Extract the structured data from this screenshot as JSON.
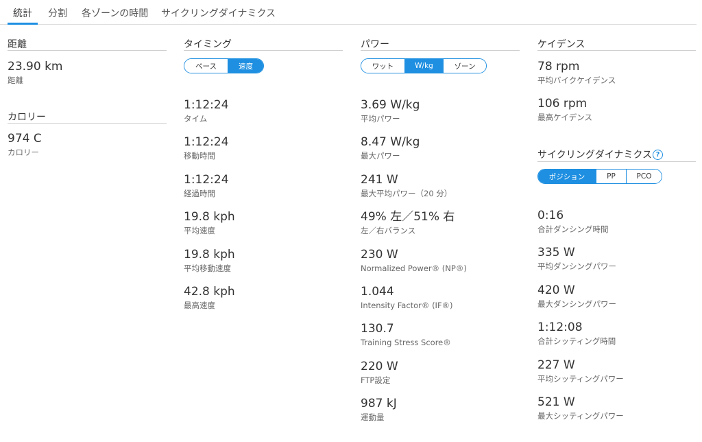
{
  "colors": {
    "accent": "#1e8fe1",
    "text": "#333333",
    "subtext": "#666666",
    "divider": "#cfcfcf"
  },
  "tabs": [
    "統計",
    "分割",
    "各ゾーンの時間",
    "サイクリングダイナミクス"
  ],
  "distance": {
    "heading": "距離",
    "value": "23.90 km",
    "label": "距離"
  },
  "calories": {
    "heading": "カロリー",
    "value": "974 C",
    "label": "カロリー"
  },
  "timing": {
    "heading": "タイミング",
    "toggle": [
      "ペース",
      "速度"
    ],
    "selected": "速度",
    "stats": [
      {
        "value": "1:12:24",
        "label": "タイム"
      },
      {
        "value": "1:12:24",
        "label": "移動時間"
      },
      {
        "value": "1:12:24",
        "label": "経過時間"
      },
      {
        "value": "19.8 kph",
        "label": "平均速度"
      },
      {
        "value": "19.8 kph",
        "label": "平均移動速度"
      },
      {
        "value": "42.8 kph",
        "label": "最高速度"
      }
    ]
  },
  "power": {
    "heading": "パワー",
    "toggle": [
      "ワット",
      "W/kg",
      "ゾーン"
    ],
    "selected": "W/kg",
    "stats": [
      {
        "value": "3.69 W/kg",
        "label": "平均パワー"
      },
      {
        "value": "8.47 W/kg",
        "label": "最大パワー"
      },
      {
        "value": "241 W",
        "label": "最大平均パワー（20 分）"
      },
      {
        "value": "49% 左／51% 右",
        "label": "左／右バランス"
      },
      {
        "value": "230 W",
        "label": "Normalized Power® (NP®)"
      },
      {
        "value": "1.044",
        "label": "Intensity Factor® (IF®)"
      },
      {
        "value": "130.7",
        "label": "Training Stress Score®"
      },
      {
        "value": "220 W",
        "label": "FTP設定"
      },
      {
        "value": "987 kJ",
        "label": "運動量"
      }
    ]
  },
  "cadence": {
    "heading": "ケイデンス",
    "stats": [
      {
        "value": "78 rpm",
        "label": "平均バイクケイデンス"
      },
      {
        "value": "106 rpm",
        "label": "最高ケイデンス"
      }
    ]
  },
  "dynamics": {
    "heading": "サイクリングダイナミクス",
    "help_icon": "question-circle-icon",
    "help_glyph": "?",
    "toggle": [
      "ポジション",
      "PP",
      "PCO"
    ],
    "selected": "ポジション",
    "stats": [
      {
        "value": "0:16",
        "label": "合計ダンシング時間"
      },
      {
        "value": "335 W",
        "label": "平均ダンシングパワー"
      },
      {
        "value": "420 W",
        "label": "最大ダンシングパワー"
      },
      {
        "value": "1:12:08",
        "label": "合計シッティング時間"
      },
      {
        "value": "227 W",
        "label": "平均シッティングパワー"
      },
      {
        "value": "521 W",
        "label": "最大シッティングパワー"
      }
    ]
  }
}
